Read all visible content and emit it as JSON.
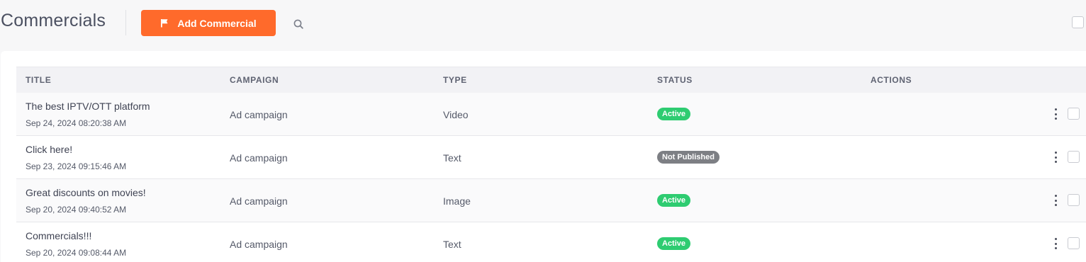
{
  "header": {
    "title": "Commercials",
    "add_label": "Add Commercial"
  },
  "columns": [
    "TITLE",
    "CAMPAIGN",
    "TYPE",
    "STATUS",
    "ACTIONS"
  ],
  "colors": {
    "accent": "#ff6a2b",
    "active": "#2ecc71",
    "not_published": "#7d7f84"
  },
  "rows": [
    {
      "title": "The best IPTV/OTT platform",
      "date": "Sep 24, 2024 08:20:38 AM",
      "campaign": "Ad campaign",
      "type": "Video",
      "status": "Active",
      "status_kind": "active"
    },
    {
      "title": "Click here!",
      "date": "Sep 23, 2024 09:15:46 AM",
      "campaign": "Ad campaign",
      "type": "Text",
      "status": "Not Published",
      "status_kind": "not_published"
    },
    {
      "title": "Great discounts on movies!",
      "date": "Sep 20, 2024 09:40:52 AM",
      "campaign": "Ad campaign",
      "type": "Image",
      "status": "Active",
      "status_kind": "active"
    },
    {
      "title": "Commercials!!!",
      "date": "Sep 20, 2024 09:08:44 AM",
      "campaign": "Ad campaign",
      "type": "Text",
      "status": "Active",
      "status_kind": "active"
    }
  ],
  "icons": {
    "add": "flag-icon",
    "search": "search-icon",
    "row_menu": "more-vertical-icon"
  }
}
